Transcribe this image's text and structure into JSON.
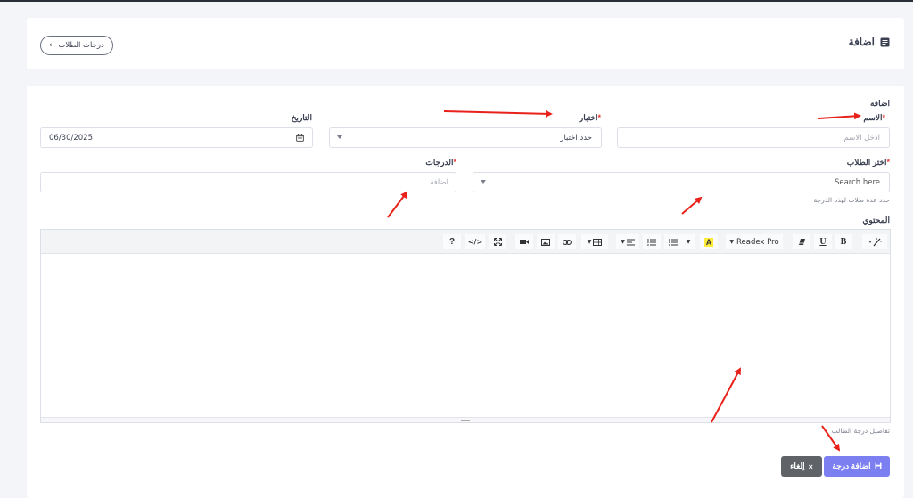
{
  "header": {
    "title": "اضافة",
    "back_label": "درجات الطلاب",
    "back_arrow": "←"
  },
  "form": {
    "section_title": "اضافة",
    "name": {
      "label": "الاسم",
      "required": "*",
      "placeholder": "ادخل الاسم"
    },
    "choice": {
      "label": "اختبار",
      "required": "*",
      "selected": "حدد اختبار"
    },
    "date": {
      "label": "التاريخ",
      "value": "06/30/2025"
    },
    "students": {
      "label": "اختر الطلاب",
      "required": "*",
      "placeholder": "Search here",
      "hint": "حدد عدة طلاب لهذه الدرجة"
    },
    "grades": {
      "label": "الدرجات",
      "required": "*",
      "placeholder": "اضافة"
    },
    "content": {
      "label": "المحتوي",
      "hint": "تفاصيل درجة الطالب"
    }
  },
  "editor": {
    "toolbar": {
      "bold": "B",
      "underline": "U",
      "font_name": "Readex Pro",
      "color_letter": "A",
      "code": "</>",
      "help": "?"
    }
  },
  "actions": {
    "submit_label": "اضافة درجة",
    "cancel_label": "إلغاء",
    "cancel_symbol": "×"
  },
  "colors": {
    "primary": "#7b7ff0",
    "secondary": "#5f6368",
    "required": "#e53935",
    "annotation": "#e8221b",
    "highlight": "#ffeb3b"
  }
}
